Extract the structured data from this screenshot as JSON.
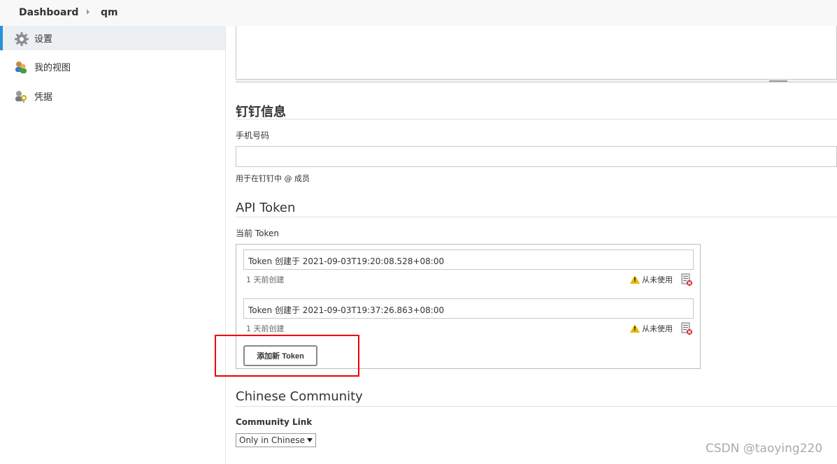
{
  "breadcrumb": {
    "root": "Dashboard",
    "current": "qm"
  },
  "sidebar": {
    "items": [
      {
        "label": "设置",
        "icon": "gear-icon",
        "active": true
      },
      {
        "label": "我的视图",
        "icon": "users-view-icon",
        "active": false
      },
      {
        "label": "凭据",
        "icon": "credentials-icon",
        "active": false
      }
    ]
  },
  "dingtalk": {
    "title": "钉钉信息",
    "phone_label": "手机号码",
    "phone_value": "",
    "help": "用于在钉钉中 @ 成员"
  },
  "api_token": {
    "title": "API Token",
    "current_label": "当前 Token",
    "tokens": [
      {
        "name": "Token 创建于 2021-09-03T19:20:08.528+08:00",
        "created": "1 天前创建",
        "usage": "从未使用"
      },
      {
        "name": "Token 创建于 2021-09-03T19:37:26.863+08:00",
        "created": "1 天前创建",
        "usage": "从未使用"
      }
    ],
    "add_button": "添加新 Token"
  },
  "community": {
    "title": "Chinese Community",
    "link_label": "Community Link",
    "link_value": "Only in Chinese"
  },
  "watermark": "CSDN @taoying220",
  "colors": {
    "accent": "#2b8fd6",
    "highlight": "#e00000",
    "warning": "#e6b800"
  }
}
